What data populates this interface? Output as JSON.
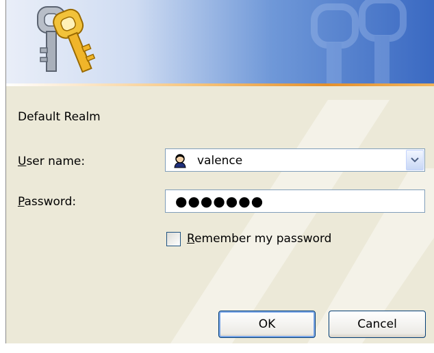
{
  "dialog": {
    "realm": "Default Realm",
    "user_label_accel": "U",
    "user_label_rest": "ser name:",
    "username_value": "valence",
    "password_label_accel": "P",
    "password_label_rest": "assword:",
    "password_masked": "●●●●●●●",
    "remember_accel": "R",
    "remember_rest": "emember my password",
    "remember_checked": false,
    "ok_label": "OK",
    "cancel_label": "Cancel"
  },
  "icons": {
    "banner": "keys-icon",
    "user": "user-icon",
    "dropdown": "chevron-down-icon"
  },
  "colors": {
    "dialog_bg": "#ece9d8",
    "banner_blue": "#3a69c2",
    "accent_stripe": "#e4902c",
    "field_border": "#7f9db9"
  }
}
